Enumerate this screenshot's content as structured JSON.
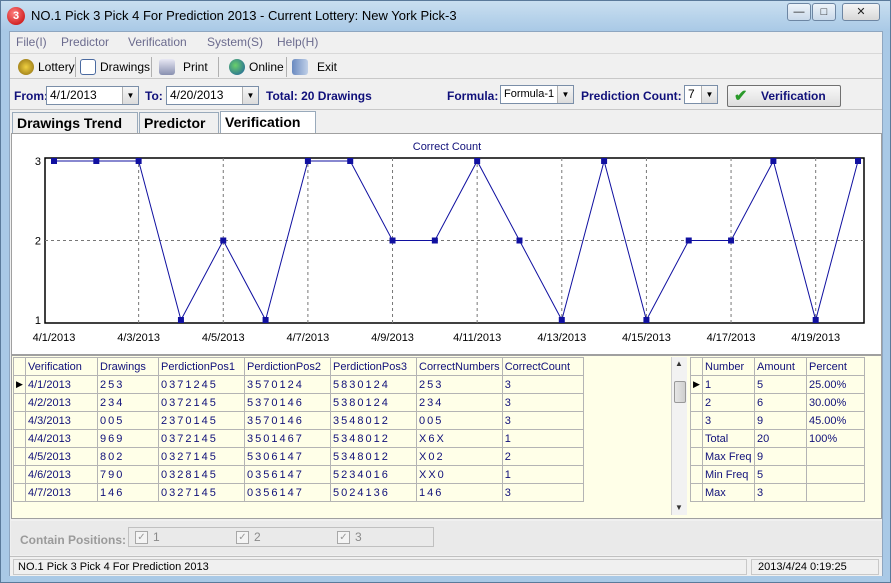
{
  "window": {
    "title": "NO.1 Pick 3 Pick 4 For Prediction 2013 - Current Lottery: New York Pick-3",
    "icon_text": "3",
    "min": "—",
    "max": "□",
    "close": "✕"
  },
  "menu": [
    "File(I)",
    "Predictor",
    "Verification",
    "System(S)",
    "Help(H)"
  ],
  "toolbar": {
    "lottery": "Lottery",
    "drawings": "Drawings",
    "print": "Print",
    "online": "Online",
    "exit": "Exit"
  },
  "filter": {
    "from_label": "From:",
    "from_value": "4/1/2013",
    "to_label": "To:",
    "to_value": "4/20/2013",
    "total": "Total: 20 Drawings",
    "formula_label": "Formula:",
    "formula_value": "Formula-1",
    "count_label": "Prediction Count:",
    "count_value": "7",
    "verify_button": "Verification"
  },
  "tabs": [
    "Drawings Trend",
    "Predictor",
    "Verification"
  ],
  "chart_data": {
    "type": "line",
    "title": "Correct Count",
    "x": [
      "4/1/2013",
      "4/2/2013",
      "4/3/2013",
      "4/4/2013",
      "4/5/2013",
      "4/6/2013",
      "4/7/2013",
      "4/8/2013",
      "4/9/2013",
      "4/10/2013",
      "4/11/2013",
      "4/12/2013",
      "4/13/2013",
      "4/14/2013",
      "4/15/2013",
      "4/16/2013",
      "4/17/2013",
      "4/18/2013",
      "4/19/2013",
      "4/20/2013"
    ],
    "xticks": [
      "4/1/2013",
      "4/3/2013",
      "4/5/2013",
      "4/7/2013",
      "4/9/2013",
      "4/11/2013",
      "4/13/2013",
      "4/15/2013",
      "4/17/2013",
      "4/19/2013"
    ],
    "series": [
      {
        "values": [
          3,
          3,
          3,
          1,
          2,
          1,
          3,
          3,
          2,
          2,
          3,
          2,
          1,
          3,
          1,
          2,
          2,
          3,
          1,
          3
        ],
        "color": "#1010a0"
      }
    ],
    "yticks": [
      "1",
      "2",
      "3"
    ],
    "ylim": [
      1,
      3
    ],
    "grid": true
  },
  "grid": {
    "columns": [
      "Verification",
      "Drawings",
      "PerdictionPos1",
      "PerdictionPos2",
      "PerdictionPos3",
      "CorrectNumbers",
      "CorrectCount"
    ],
    "rows": [
      [
        "4/1/2013",
        "253",
        "0371245",
        "3570124",
        "5830124",
        "253",
        "3"
      ],
      [
        "4/2/2013",
        "234",
        "0372145",
        "5370146",
        "5380124",
        "234",
        "3"
      ],
      [
        "4/3/2013",
        "005",
        "2370145",
        "3570146",
        "3548012",
        "005",
        "3"
      ],
      [
        "4/4/2013",
        "969",
        "0372145",
        "3501467",
        "5348012",
        "X6X",
        "1"
      ],
      [
        "4/5/2013",
        "802",
        "0327145",
        "5306147",
        "5348012",
        "X02",
        "2"
      ],
      [
        "4/6/2013",
        "790",
        "0328145",
        "0356147",
        "5234016",
        "XX0",
        "1"
      ],
      [
        "4/7/2013",
        "146",
        "0327145",
        "0356147",
        "5024136",
        "146",
        "3"
      ]
    ]
  },
  "stats": {
    "columns": [
      "Number",
      "Amount",
      "Percent"
    ],
    "rows": [
      [
        "1",
        "5",
        "25.00%"
      ],
      [
        "2",
        "6",
        "30.00%"
      ],
      [
        "3",
        "9",
        "45.00%"
      ],
      [
        "Total",
        "20",
        "100%"
      ],
      [
        "Max Freq",
        "9",
        ""
      ],
      [
        "Min Freq",
        "5",
        ""
      ],
      [
        "Max",
        "3",
        ""
      ]
    ]
  },
  "contain": {
    "label": "Contain Positions:",
    "positions": [
      "1",
      "2",
      "3"
    ]
  },
  "status": {
    "left": "NO.1 Pick 3 Pick 4 For Prediction 2013",
    "right": "2013/4/24 0:19:25"
  }
}
